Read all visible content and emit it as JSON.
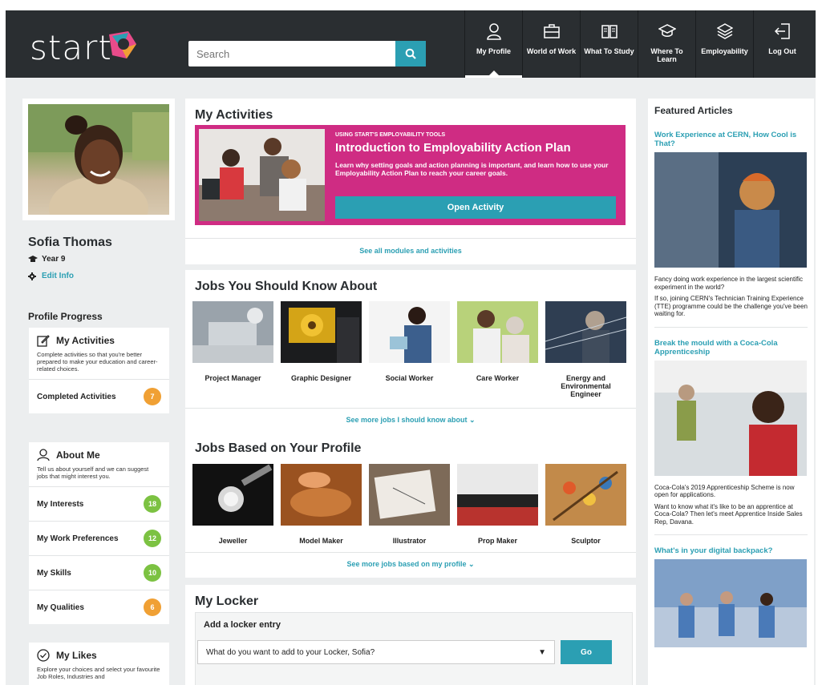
{
  "header": {
    "logo_text": "start",
    "search_placeholder": "Search",
    "nav": [
      {
        "label": "My Profile",
        "icon": "person-icon",
        "active": true
      },
      {
        "label": "World of Work",
        "icon": "briefcase-icon",
        "active": false
      },
      {
        "label": "What To Study",
        "icon": "book-icon",
        "active": false
      },
      {
        "label": "Where To Learn",
        "icon": "graduation-cap-icon",
        "active": false
      },
      {
        "label": "Employability",
        "icon": "layers-icon",
        "active": false
      },
      {
        "label": "Log Out",
        "icon": "logout-icon",
        "active": false
      }
    ]
  },
  "profile": {
    "name": "Sofia Thomas",
    "year": "Year 9",
    "edit_label": "Edit Info",
    "progress_title": "Profile Progress"
  },
  "left_cards": {
    "activities": {
      "title": "My Activities",
      "desc": "Complete activities so that you're better prepared to make your education and career-related choices.",
      "rows": [
        {
          "label": "Completed Activities",
          "count": "7",
          "color": "#f0a034"
        }
      ]
    },
    "about": {
      "title": "About Me",
      "desc": "Tell us about yourself and we can suggest jobs that might interest you.",
      "rows": [
        {
          "label": "My Interests",
          "count": "18",
          "color": "#7cc242"
        },
        {
          "label": "My Work Preferences",
          "count": "12",
          "color": "#7cc242"
        },
        {
          "label": "My Skills",
          "count": "10",
          "color": "#7cc242"
        },
        {
          "label": "My Qualities",
          "count": "6",
          "color": "#f0a034"
        }
      ]
    },
    "likes": {
      "title": "My Likes",
      "desc": "Explore your choices and select your favourite Job Roles, Industries and"
    }
  },
  "my_activities": {
    "title": "My Activities",
    "kicker": "USING START'S EMPLOYABILITY TOOLS",
    "promo_title": "Introduction to Employability Action Plan",
    "promo_text": "Learn why setting goals and action planning is important, and learn how to use your Employability Action Plan to reach your career goals.",
    "button": "Open Activity",
    "see_all": "See all modules and activities"
  },
  "jobs_know": {
    "title": "Jobs You Should Know About",
    "items": [
      "Project Manager",
      "Graphic Designer",
      "Social Worker",
      "Care Worker",
      "Energy and Environmental Engineer"
    ],
    "see_more": "See more jobs I should know about"
  },
  "jobs_profile": {
    "title": "Jobs Based on Your Profile",
    "items": [
      "Jeweller",
      "Model Maker",
      "Illustrator",
      "Prop Maker",
      "Sculptor"
    ],
    "see_more": "See more jobs based on my profile"
  },
  "locker": {
    "title": "My Locker",
    "subtitle": "Add a locker entry",
    "select_value": "What do you want to add to your Locker, Sofia?",
    "go": "Go"
  },
  "featured": {
    "title": "Featured Articles",
    "articles": [
      {
        "title": "Work Experience at CERN, How Cool is That?",
        "p1": "Fancy doing work experience in the largest scientific experiment in the world?",
        "p2": "If so, joining CERN's Technician Training Experience (TTE) programme could be the challenge you've been waiting for."
      },
      {
        "title": "Break the mould with a Coca-Cola Apprenticeship",
        "p1": "Coca-Cola's 2019 Apprenticeship Scheme is now open for applications.",
        "p2": "Want to know what it's like to be an apprentice at Coca-Cola? Then let's meet Apprentice Inside Sales Rep, Davana."
      },
      {
        "title": "What's in your digital backpack?"
      }
    ]
  },
  "colors": {
    "accent": "#2b9fb3",
    "promo": "#cf2c83",
    "header": "#2a2e31",
    "badge_green": "#7cc242",
    "badge_orange": "#f0a034"
  }
}
